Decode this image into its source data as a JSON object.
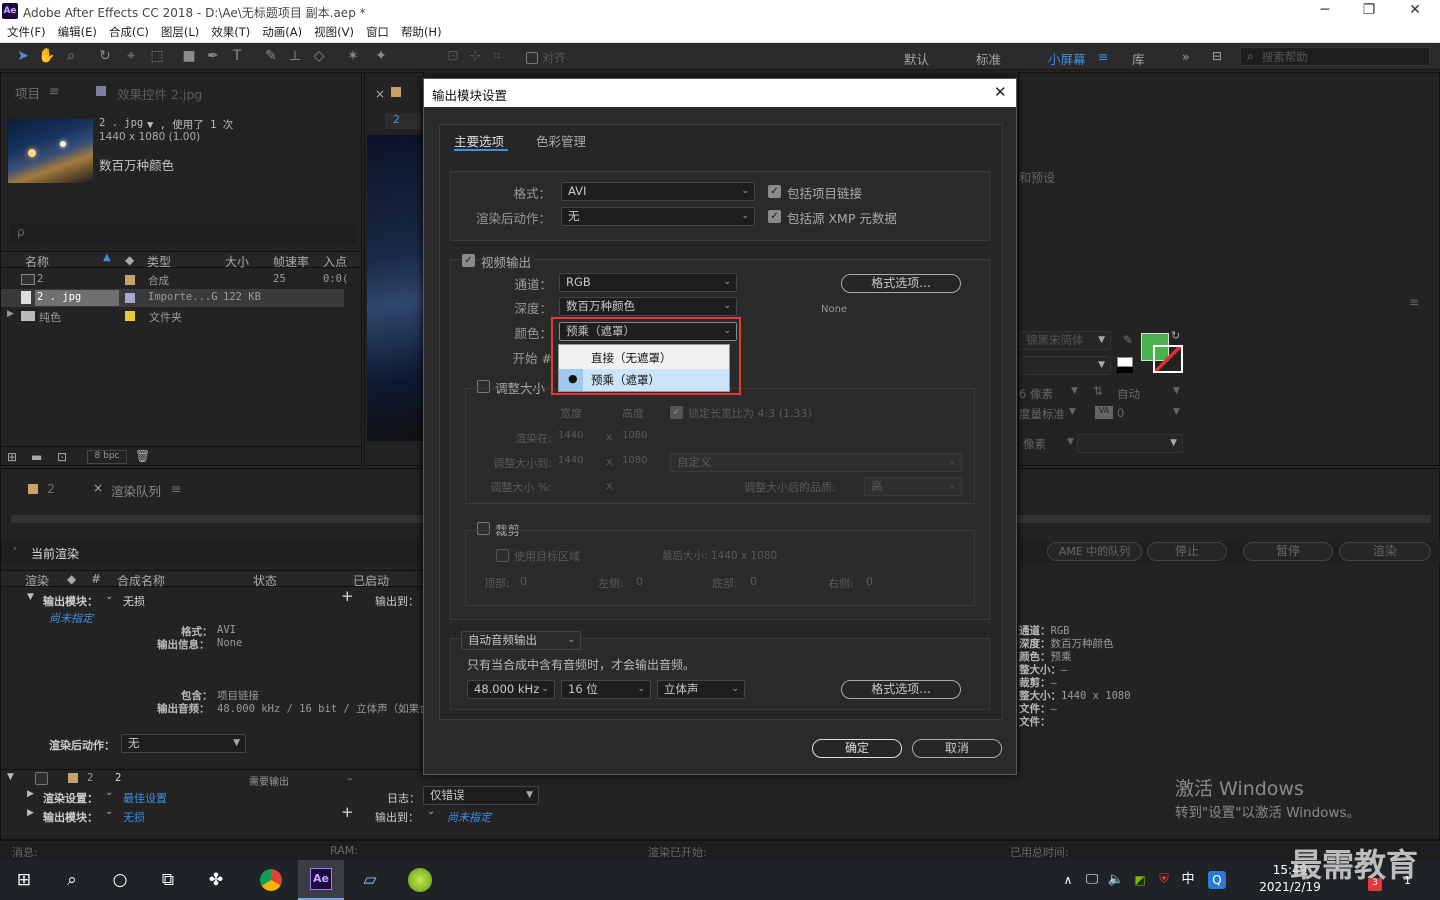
{
  "titlebar": {
    "logo": "Ae",
    "title": "Adobe After Effects CC 2018 - D:\\Ae\\无标题项目 副本.aep *",
    "min": "─",
    "max": "❐",
    "close": "✕"
  },
  "menu": [
    "文件(F)",
    "编辑(E)",
    "合成(C)",
    "图层(L)",
    "效果(T)",
    "动画(A)",
    "视图(V)",
    "窗口",
    "帮助(H)"
  ],
  "toolbar": {
    "align_label": "对齐",
    "workspaces": [
      "默认",
      "标准",
      "小屏幕",
      "库"
    ],
    "active_workspace": "小屏幕",
    "more": "»",
    "search_placeholder": "搜索帮助"
  },
  "project": {
    "tab_project": "项目",
    "tab_effects": "效果控件 2.jpg",
    "file_name": "2 . jpg",
    "file_used": "▼ , 使用了 1 次",
    "file_dims": "1440 x 1080 (1.00)",
    "file_color": "数百万种颜色",
    "search_icon": "ρ",
    "columns": [
      "名称",
      "类型",
      "大小",
      "帧速率",
      "入点"
    ],
    "rows": [
      {
        "name": "2",
        "type": "合成",
        "size": "",
        "fps": "25",
        "in": "0:0("
      },
      {
        "name": "2 . jpg",
        "type": "Importe...G",
        "size": "122 KB",
        "fps": "",
        "in": ""
      },
      {
        "name": "纯色",
        "type": "文件夹",
        "size": "",
        "fps": "",
        "in": ""
      }
    ],
    "bpc": "8 bpc"
  },
  "comp": {
    "tab": "2"
  },
  "renderqueue": {
    "tab_comp": "2",
    "tab_rq": "渲染队列",
    "current": "当前渲染",
    "cols": [
      "渲染",
      "#",
      "合成名称",
      "状态",
      "已启动"
    ],
    "output_module": "输出模块：",
    "output_module_value": "无损",
    "output_to": "输出到：",
    "not_specified": "尚未指定",
    "format_lbl": "格式：",
    "format_val": "AVI",
    "out_info_lbl": "输出信息：",
    "out_info_val": "None",
    "include_lbl": "包含：",
    "include_val": "项目链接",
    "audio_lbl": "输出音频：",
    "audio_val": "48.000 kHz / 16 bit / 立体声（如果合",
    "post_render": "渲染后动作：",
    "post_render_val": "无",
    "item_num": "2",
    "item_name": "2",
    "item_status": "需要输出",
    "item_dash": "–",
    "render_settings": "渲染设置：",
    "render_settings_val": "最佳设置",
    "log": "日志：",
    "log_val": "仅错误",
    "output_module2": "输出模块：",
    "output_module2_val": "无损",
    "output_to2": "输出到：",
    "output_to2_val": "尚未指定",
    "ame_btn": "AME 中的队列",
    "stop_btn": "停止",
    "pause_btn": "暂停",
    "render_btn": "渲染",
    "right_info": [
      [
        "通道：",
        "RGB"
      ],
      [
        "深度：",
        "数百万种颜色"
      ],
      [
        "颜色：",
        "预乘"
      ],
      [
        "整大小：",
        "–"
      ],
      [
        "裁剪：",
        "–"
      ],
      [
        "整大小：",
        "1440 x 1080"
      ],
      [
        "文件：",
        "–"
      ],
      [
        "文件：",
        ""
      ]
    ]
  },
  "status": {
    "msg": "消息:",
    "ram": "RAM:",
    "started": "渲染已开始:",
    "total": "已用总时间:"
  },
  "right": {
    "presets": "和预设",
    "font": "锦黑宋简体",
    "px": "6 像素",
    "auto": "自动",
    "metric": "度量标准",
    "zero": "0",
    "px2": "像素",
    "fill_color": "#4caf50"
  },
  "dialog": {
    "title": "输出模块设置",
    "close": "✕",
    "tab_main": "主要选项",
    "tab_color": "色彩管理",
    "format_lbl": "格式：",
    "format_val": "AVI",
    "post_lbl": "渲染后动作：",
    "post_val": "无",
    "include_link": "包括项目链接",
    "include_xmp": "包括源 XMP 元数据",
    "video_output": "视频输出",
    "channel_lbl": "通道：",
    "channel_val": "RGB",
    "depth_lbl": "深度：",
    "depth_val": "数百万种颜色",
    "color_lbl": "颜色：",
    "color_val": "预乘（遮罩）",
    "start_lbl": "开始 #",
    "format_opts": "格式选项...",
    "none": "None",
    "dropdown": [
      "直接（无遮罩）",
      "预乘（遮罩）"
    ],
    "dropdown_selected": 1,
    "resize": "调整大小",
    "width": "宽度",
    "height": "高度",
    "lock": "锁定长宽比为 4:3 (1.33)",
    "render_at": "渲染在:",
    "resize_to": "调整大小到:",
    "resize_pct": "调整大小 %:",
    "w1": "1440",
    "h1": "1080",
    "w2": "1440",
    "h2": "1080",
    "x": "x",
    "custom": "自定义",
    "quality_lbl": "调整大小后的品质:",
    "quality_val": "高",
    "crop": "裁剪",
    "use_roi": "使用目标区域",
    "max_size": "最后大小: 1440 x 1080",
    "top": "顶部:",
    "left": "左侧:",
    "bottom": "底部:",
    "right": "右侧:",
    "zero": "0",
    "audio_mode": "自动音频输出",
    "audio_note": "只有当合成中含有音频时，才会输出音频。",
    "rate": "48.000 kHz",
    "bits": "16 位",
    "channels": "立体声",
    "ok": "确定",
    "cancel": "取消"
  },
  "watermark": {
    "line1": "激活 Windows",
    "line2": "转到\"设置\"以激活 Windows。",
    "logo": "最需教育"
  },
  "taskbar": {
    "time": "15:49",
    "date": "2021/2/19",
    "ime": "中",
    "badge": "3",
    "notif": "1"
  }
}
